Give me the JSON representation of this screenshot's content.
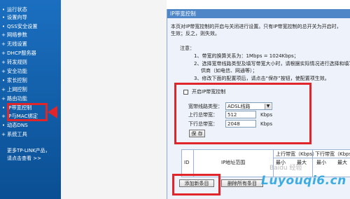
{
  "sidebar": {
    "items": [
      {
        "label": "运行状态"
      },
      {
        "label": "设置向导"
      },
      {
        "label": "QSS安全设置"
      },
      {
        "label": "网络参数"
      },
      {
        "label": "无线设置"
      },
      {
        "label": "DHCP服务器"
      },
      {
        "label": "转发规则"
      },
      {
        "label": "安全功能"
      },
      {
        "label": "家长控制"
      },
      {
        "label": "上网控制"
      },
      {
        "label": "路由功能"
      },
      {
        "label": "IP带宽控制"
      },
      {
        "label": "IP与MAC绑定"
      },
      {
        "label": "动态DNS"
      },
      {
        "label": "系统工具"
      }
    ],
    "more_line1": "更多TP-LINK产品，",
    "more_line2": "请点击查看 >>"
  },
  "panel": {
    "title": "IP带宽控制",
    "intro1": "本页对IP带宽控制的开启与关闭进行设置。只有IP带宽控制的总开关为开启时，",
    "intro2": "生效；反之，则失效。",
    "note_label": "注意：",
    "note1": "1、带宽的换算关系为：1Mbps = 1024Kbps；",
    "note2": "2、选择宽带线路类型及填写带宽大小时，请根据实际情况进行选择和填写",
    "note2b": "供商（如电信、网通等）；",
    "note3": "3、修改下面的配置项后，请点击“保存”按钮，使配置项生效。"
  },
  "settings": {
    "enable_label": "开启IP带宽控制",
    "line_type_label": "宽带线路类型：",
    "line_type_value": "ADSL线路",
    "up_label": "上行总带宽：",
    "up_value": "512",
    "up_unit": "Kbps",
    "down_label": "下行总带宽：",
    "down_value": "2048",
    "down_unit": "Kbps",
    "save_label": "保 存"
  },
  "table": {
    "col_id": "ID",
    "col_ip": "IP地址范围",
    "col_up": "上行带宽（Kbps）",
    "col_down": "下行带宽（Kbps）",
    "sub_min": "最小",
    "sub_max": "最大",
    "sub_min2": "最小",
    "sub_max2": "最大"
  },
  "actions": {
    "add_label": "添加新条目",
    "delete_all_label": "删除所有条目"
  },
  "watermark": {
    "brand": "Luyouqi6.cn",
    "faint": "Baidu 经验"
  }
}
